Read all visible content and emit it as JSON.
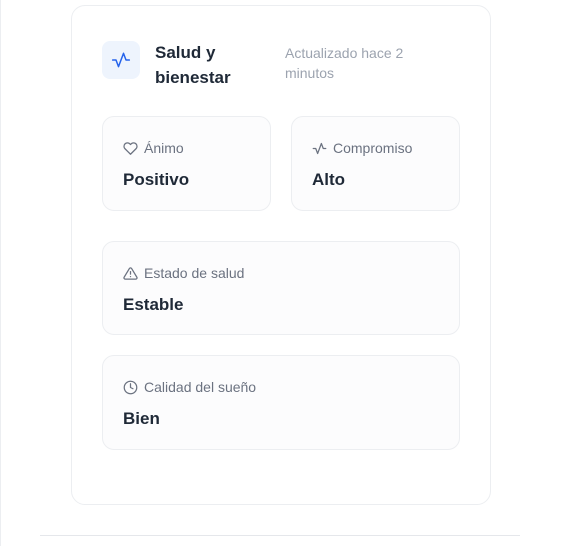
{
  "header": {
    "title": "Salud y bienestar",
    "updated": "Actualizado hace 2 minutos",
    "icon": "activity-icon"
  },
  "tiles": [
    {
      "label": "Ánimo",
      "value": "Positivo",
      "icon": "heart-icon"
    },
    {
      "label": "Compromiso",
      "value": "Alto",
      "icon": "activity-icon"
    },
    {
      "label": "Estado de salud",
      "value": "Estable",
      "icon": "alert-triangle-icon"
    },
    {
      "label": "Calidad del sueño",
      "value": "Bien",
      "icon": "clock-icon"
    }
  ],
  "colors": {
    "accent": "#2563eb",
    "icon_bg": "#eef4fd",
    "muted_text": "#6b7280",
    "timestamp_text": "#9ca3af"
  }
}
